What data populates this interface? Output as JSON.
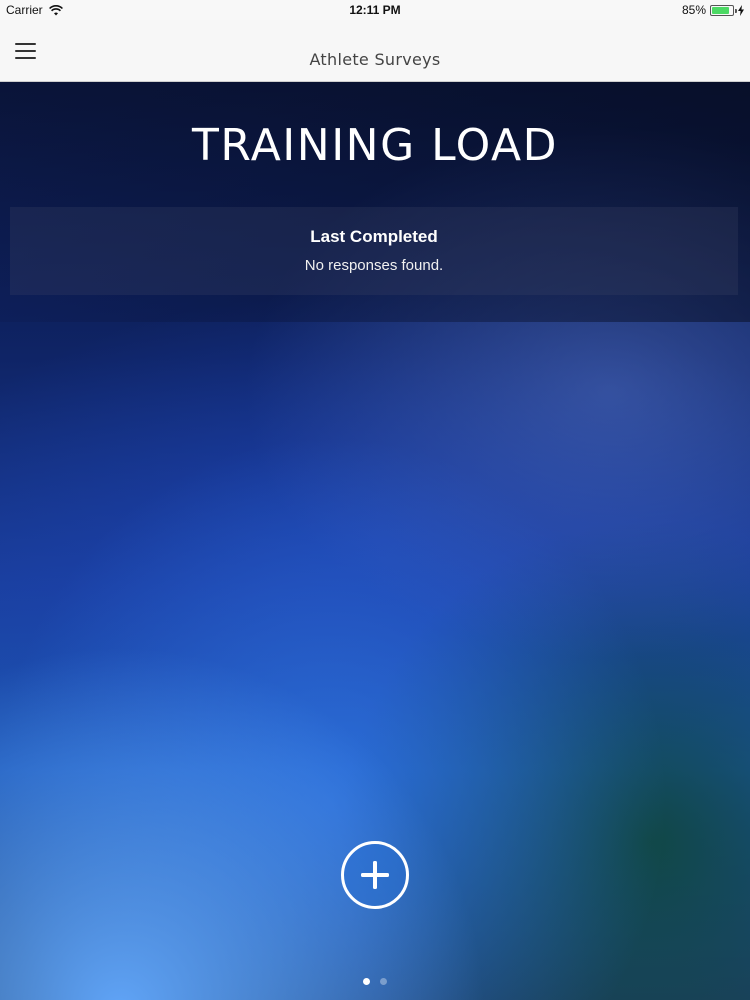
{
  "status_bar": {
    "carrier": "Carrier",
    "time": "12:11 PM",
    "battery_percent": "85%",
    "battery_level": 0.85,
    "icons": [
      "wifi-icon",
      "battery-icon",
      "bolt-icon"
    ]
  },
  "nav": {
    "title": "Athlete Surveys",
    "menu_icon": "menu-icon"
  },
  "main": {
    "title": "TRAINING LOAD",
    "last_completed": {
      "heading": "Last Completed",
      "message": "No responses found."
    },
    "add_icon": "plus-icon"
  },
  "pager": {
    "count": 2,
    "active_index": 0
  },
  "colors": {
    "battery": "#4cd964",
    "title_text": "#ffffff",
    "nav_bg": "#f7f7f7"
  }
}
